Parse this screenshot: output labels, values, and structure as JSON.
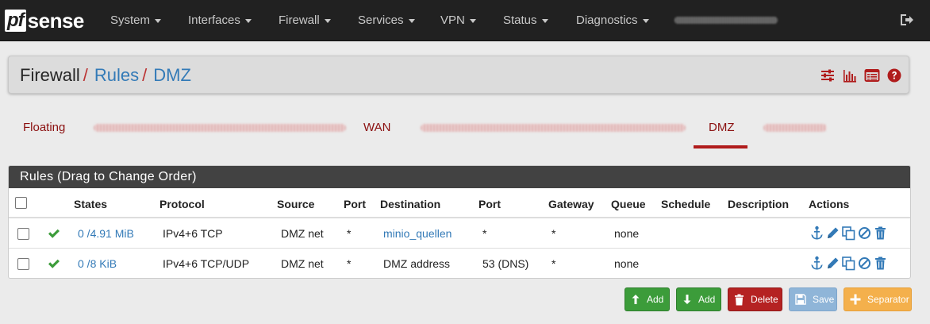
{
  "navbar": {
    "logo_pf": "pf",
    "logo_sense": "sense",
    "menu": [
      "System",
      "Interfaces",
      "Firewall",
      "Services",
      "VPN",
      "Status",
      "Diagnostics"
    ]
  },
  "breadcrumb": {
    "first": "Firewall",
    "second": "Rules",
    "third": "DMZ",
    "sep": "/"
  },
  "tabs": {
    "floating": "Floating",
    "wan": "WAN",
    "dmz": "DMZ"
  },
  "rules": {
    "title": "Rules (Drag to Change Order)",
    "columns": {
      "states": "States",
      "protocol": "Protocol",
      "source": "Source",
      "port": "Port",
      "destination": "Destination",
      "dport": "Port",
      "gateway": "Gateway",
      "queue": "Queue",
      "schedule": "Schedule",
      "description": "Description",
      "actions": "Actions"
    },
    "rows": [
      {
        "states": "0 /4.91 MiB",
        "protocol": "IPv4+6 TCP",
        "source": "DMZ net",
        "port": "*",
        "destination": "minio_quellen",
        "dport": "*",
        "gateway": "*",
        "queue": "none",
        "schedule": "",
        "description": ""
      },
      {
        "states": "0 /8 KiB",
        "protocol": "IPv4+6 TCP/UDP",
        "source": "DMZ net",
        "port": "*",
        "destination": "DMZ address",
        "dport": "53 (DNS)",
        "gateway": "*",
        "queue": "none",
        "schedule": "",
        "description": ""
      }
    ]
  },
  "buttons": {
    "add_top": "Add",
    "add_bottom": "Add",
    "delete": "Delete",
    "save": "Save",
    "separator": "Separator"
  },
  "colors": {
    "navbar": "#212121",
    "accent_red": "#b01c1c",
    "link_blue": "#337ab7",
    "success": "#3c9c3a",
    "danger": "#b52222",
    "warning": "#f4b04c"
  }
}
